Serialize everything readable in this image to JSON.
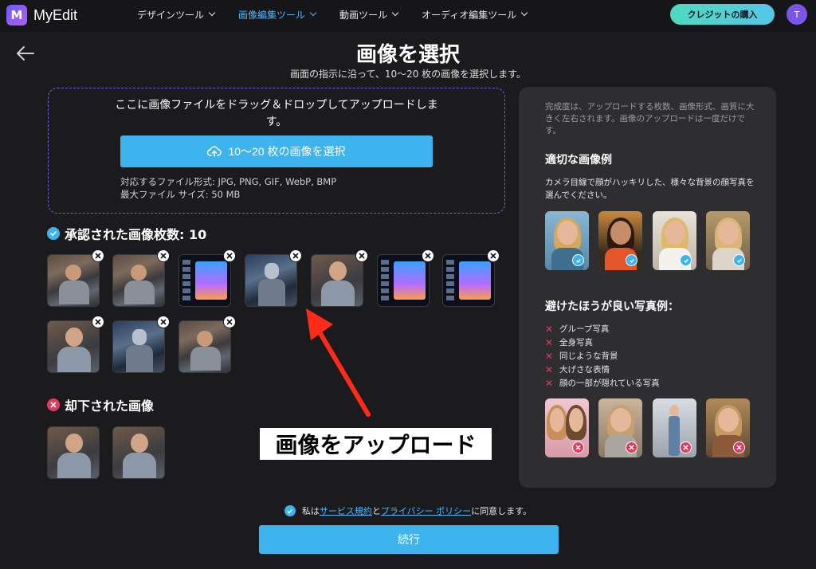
{
  "header": {
    "app_name": "MyEdit",
    "logo_letter": "M",
    "nav": [
      {
        "label": "デザインツール"
      },
      {
        "label": "画像編集ツール"
      },
      {
        "label": "動画ツール"
      },
      {
        "label": "オーディオ編集ツール"
      }
    ],
    "credit_button": "クレジットの購入",
    "avatar_letter": "T"
  },
  "page": {
    "title": "画像を選択",
    "subtitle": "画面の指示に沿って、10～20 枚の画像を選択します。"
  },
  "upload": {
    "drop_text": "ここに画像ファイルをドラッグ＆ドロップしてアップロードします。",
    "select_button": "10～20 枚の画像を選択",
    "formats": "対応するファイル形式: JPG, PNG, GIF, WebP, BMP",
    "max_size": "最大ファイル サイズ: 50 MB"
  },
  "approved": {
    "heading": "承認された画像枚数: 10",
    "count": 10
  },
  "rejected": {
    "heading": "却下された画像",
    "count": 2
  },
  "guide": {
    "note": "完成度は、アップロードする枚数、画像形式、画質に大きく左右されます。画像のアップロードは一度だけです。",
    "good_heading": "適切な画像例",
    "good_desc": "カメラ目線で顔がハッキリした、様々な背景の顔写真を選んでください。",
    "bad_heading": "避けたほうが良い写真例：",
    "bad_items": [
      "グループ写真",
      "全身写真",
      "同じような背景",
      "大げさな表情",
      "顔の一部が隠れている写真"
    ]
  },
  "annotation": {
    "label": "画像をアップロード"
  },
  "footer": {
    "agree_prefix": "私は",
    "terms_link": "サービス規約",
    "agree_mid": "と",
    "privacy_link": "プライバシー ポリシー",
    "agree_suffix": "に同意します。",
    "continue_button": "続行"
  },
  "colors": {
    "accent": "#3db4ee",
    "reject": "#e23a61",
    "background": "#1b1b1d",
    "panel": "#2e2e31"
  }
}
